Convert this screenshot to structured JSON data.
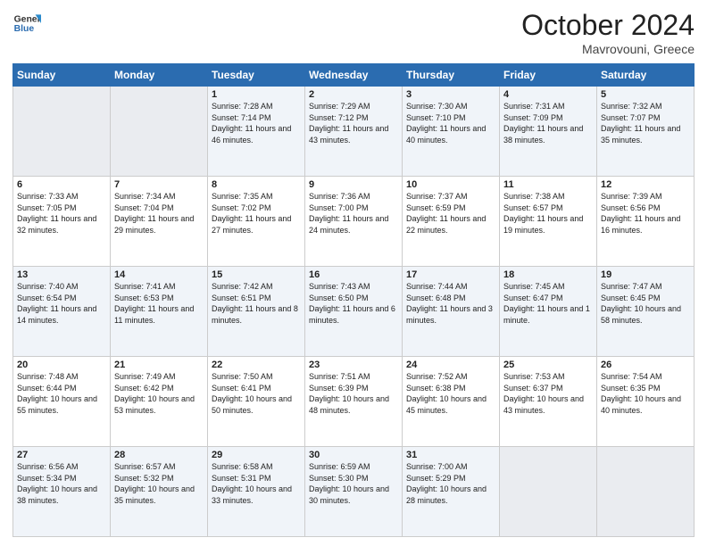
{
  "header": {
    "logo_line1": "General",
    "logo_line2": "Blue",
    "month": "October 2024",
    "location": "Mavrovouni, Greece"
  },
  "weekdays": [
    "Sunday",
    "Monday",
    "Tuesday",
    "Wednesday",
    "Thursday",
    "Friday",
    "Saturday"
  ],
  "weeks": [
    [
      {
        "day": "",
        "info": ""
      },
      {
        "day": "",
        "info": ""
      },
      {
        "day": "1",
        "info": "Sunrise: 7:28 AM\nSunset: 7:14 PM\nDaylight: 11 hours and 46 minutes."
      },
      {
        "day": "2",
        "info": "Sunrise: 7:29 AM\nSunset: 7:12 PM\nDaylight: 11 hours and 43 minutes."
      },
      {
        "day": "3",
        "info": "Sunrise: 7:30 AM\nSunset: 7:10 PM\nDaylight: 11 hours and 40 minutes."
      },
      {
        "day": "4",
        "info": "Sunrise: 7:31 AM\nSunset: 7:09 PM\nDaylight: 11 hours and 38 minutes."
      },
      {
        "day": "5",
        "info": "Sunrise: 7:32 AM\nSunset: 7:07 PM\nDaylight: 11 hours and 35 minutes."
      }
    ],
    [
      {
        "day": "6",
        "info": "Sunrise: 7:33 AM\nSunset: 7:05 PM\nDaylight: 11 hours and 32 minutes."
      },
      {
        "day": "7",
        "info": "Sunrise: 7:34 AM\nSunset: 7:04 PM\nDaylight: 11 hours and 29 minutes."
      },
      {
        "day": "8",
        "info": "Sunrise: 7:35 AM\nSunset: 7:02 PM\nDaylight: 11 hours and 27 minutes."
      },
      {
        "day": "9",
        "info": "Sunrise: 7:36 AM\nSunset: 7:00 PM\nDaylight: 11 hours and 24 minutes."
      },
      {
        "day": "10",
        "info": "Sunrise: 7:37 AM\nSunset: 6:59 PM\nDaylight: 11 hours and 22 minutes."
      },
      {
        "day": "11",
        "info": "Sunrise: 7:38 AM\nSunset: 6:57 PM\nDaylight: 11 hours and 19 minutes."
      },
      {
        "day": "12",
        "info": "Sunrise: 7:39 AM\nSunset: 6:56 PM\nDaylight: 11 hours and 16 minutes."
      }
    ],
    [
      {
        "day": "13",
        "info": "Sunrise: 7:40 AM\nSunset: 6:54 PM\nDaylight: 11 hours and 14 minutes."
      },
      {
        "day": "14",
        "info": "Sunrise: 7:41 AM\nSunset: 6:53 PM\nDaylight: 11 hours and 11 minutes."
      },
      {
        "day": "15",
        "info": "Sunrise: 7:42 AM\nSunset: 6:51 PM\nDaylight: 11 hours and 8 minutes."
      },
      {
        "day": "16",
        "info": "Sunrise: 7:43 AM\nSunset: 6:50 PM\nDaylight: 11 hours and 6 minutes."
      },
      {
        "day": "17",
        "info": "Sunrise: 7:44 AM\nSunset: 6:48 PM\nDaylight: 11 hours and 3 minutes."
      },
      {
        "day": "18",
        "info": "Sunrise: 7:45 AM\nSunset: 6:47 PM\nDaylight: 11 hours and 1 minute."
      },
      {
        "day": "19",
        "info": "Sunrise: 7:47 AM\nSunset: 6:45 PM\nDaylight: 10 hours and 58 minutes."
      }
    ],
    [
      {
        "day": "20",
        "info": "Sunrise: 7:48 AM\nSunset: 6:44 PM\nDaylight: 10 hours and 55 minutes."
      },
      {
        "day": "21",
        "info": "Sunrise: 7:49 AM\nSunset: 6:42 PM\nDaylight: 10 hours and 53 minutes."
      },
      {
        "day": "22",
        "info": "Sunrise: 7:50 AM\nSunset: 6:41 PM\nDaylight: 10 hours and 50 minutes."
      },
      {
        "day": "23",
        "info": "Sunrise: 7:51 AM\nSunset: 6:39 PM\nDaylight: 10 hours and 48 minutes."
      },
      {
        "day": "24",
        "info": "Sunrise: 7:52 AM\nSunset: 6:38 PM\nDaylight: 10 hours and 45 minutes."
      },
      {
        "day": "25",
        "info": "Sunrise: 7:53 AM\nSunset: 6:37 PM\nDaylight: 10 hours and 43 minutes."
      },
      {
        "day": "26",
        "info": "Sunrise: 7:54 AM\nSunset: 6:35 PM\nDaylight: 10 hours and 40 minutes."
      }
    ],
    [
      {
        "day": "27",
        "info": "Sunrise: 6:56 AM\nSunset: 5:34 PM\nDaylight: 10 hours and 38 minutes."
      },
      {
        "day": "28",
        "info": "Sunrise: 6:57 AM\nSunset: 5:32 PM\nDaylight: 10 hours and 35 minutes."
      },
      {
        "day": "29",
        "info": "Sunrise: 6:58 AM\nSunset: 5:31 PM\nDaylight: 10 hours and 33 minutes."
      },
      {
        "day": "30",
        "info": "Sunrise: 6:59 AM\nSunset: 5:30 PM\nDaylight: 10 hours and 30 minutes."
      },
      {
        "day": "31",
        "info": "Sunrise: 7:00 AM\nSunset: 5:29 PM\nDaylight: 10 hours and 28 minutes."
      },
      {
        "day": "",
        "info": ""
      },
      {
        "day": "",
        "info": ""
      }
    ]
  ]
}
